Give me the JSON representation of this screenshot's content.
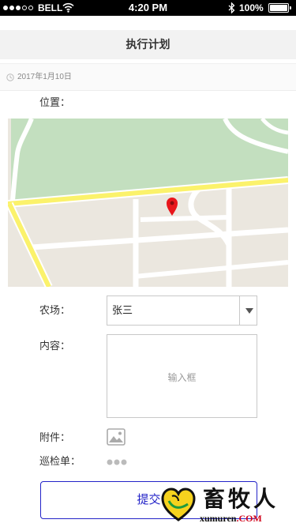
{
  "status_bar": {
    "carrier": "BELL",
    "time": "4:20 PM",
    "battery_text": "100%",
    "battery_level": 100,
    "signal_bars": 3,
    "signal_max": 5
  },
  "nav": {
    "title": "执行计划"
  },
  "date": {
    "text": "2017年1月10日"
  },
  "form": {
    "location_label": "位置：",
    "farm_label": "农场：",
    "farm_value": "张三",
    "content_label": "内容：",
    "content_placeholder": "输入框",
    "attachment_label": "附件：",
    "inspection_label": "巡检单：",
    "submit_label": "提交"
  },
  "watermark": {
    "name": "畜牧人",
    "site_name": "xumuren",
    "site_tld": ".COM"
  },
  "icons": {
    "signal": "signal-strength-icon",
    "wifi": "wifi-icon",
    "bluetooth": "bluetooth-icon",
    "battery": "battery-icon",
    "date": "clock-icon",
    "map_marker": "map-pin-icon",
    "select": "chevron-down-icon",
    "attachment": "image-icon",
    "inspection": "ellipsis-icon"
  },
  "colors": {
    "accent": "#2323c8",
    "status_bar": "#000000",
    "nav_bg": "#f2f2f2",
    "map_pin": "#e8161b",
    "map_park": "#c3dfbf",
    "map_highway": "#fbf26b"
  }
}
